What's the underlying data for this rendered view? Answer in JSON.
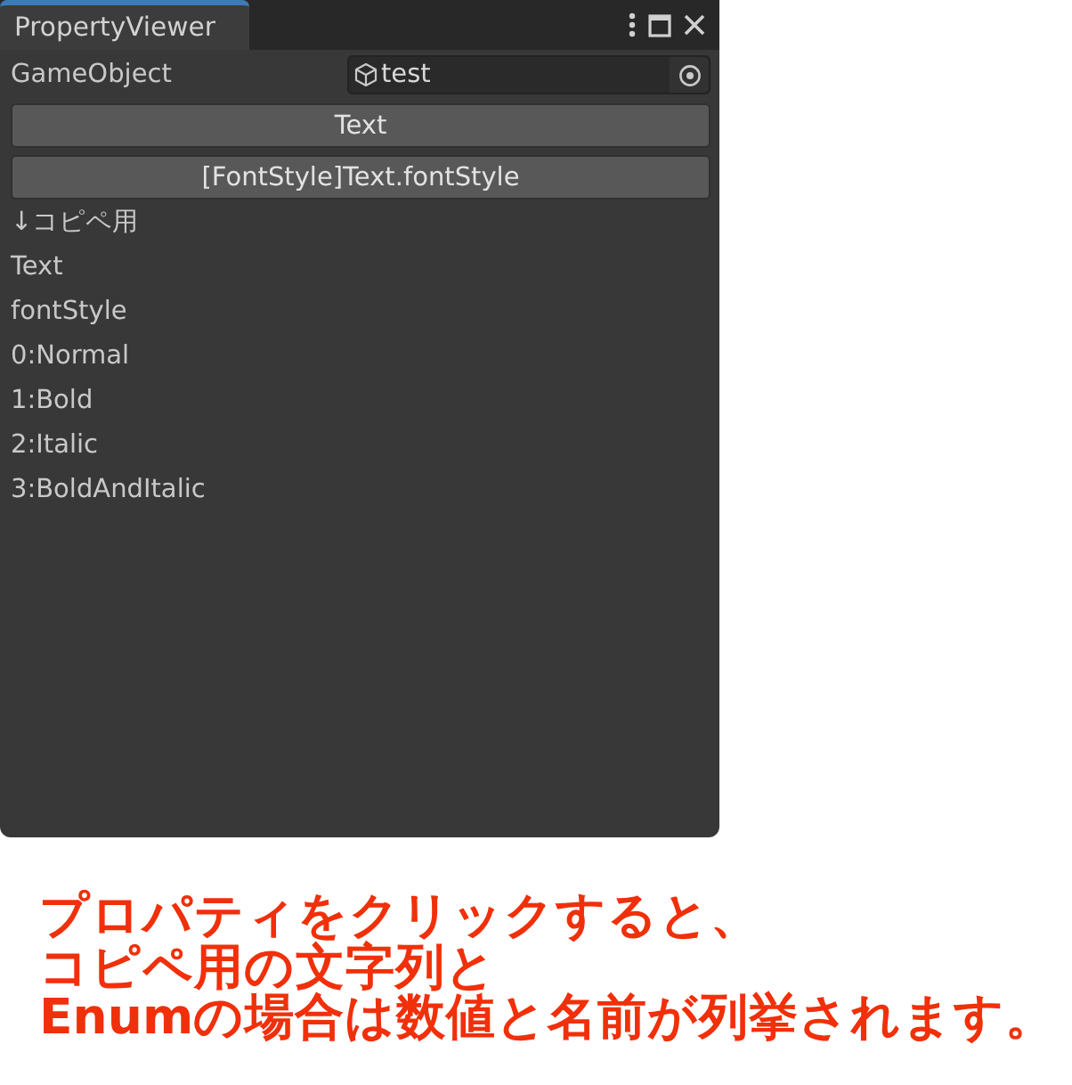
{
  "window": {
    "tabs": [
      {
        "label": "PropertyViewer",
        "selected": true
      }
    ]
  },
  "object_field": {
    "label": "GameObject",
    "value": "test"
  },
  "buttons": [
    "Text",
    "[FontStyle]Text.fontStyle"
  ],
  "lines": [
    "↓コピペ用",
    "Text",
    "fontStyle",
    "0:Normal",
    "1:Bold",
    "2:Italic",
    "3:BoldAndItalic"
  ],
  "caption": [
    "プロパティをクリックすると、",
    "コピペ用の文字列と",
    "Enumの場合は数値と名前が列挙されます。"
  ]
}
